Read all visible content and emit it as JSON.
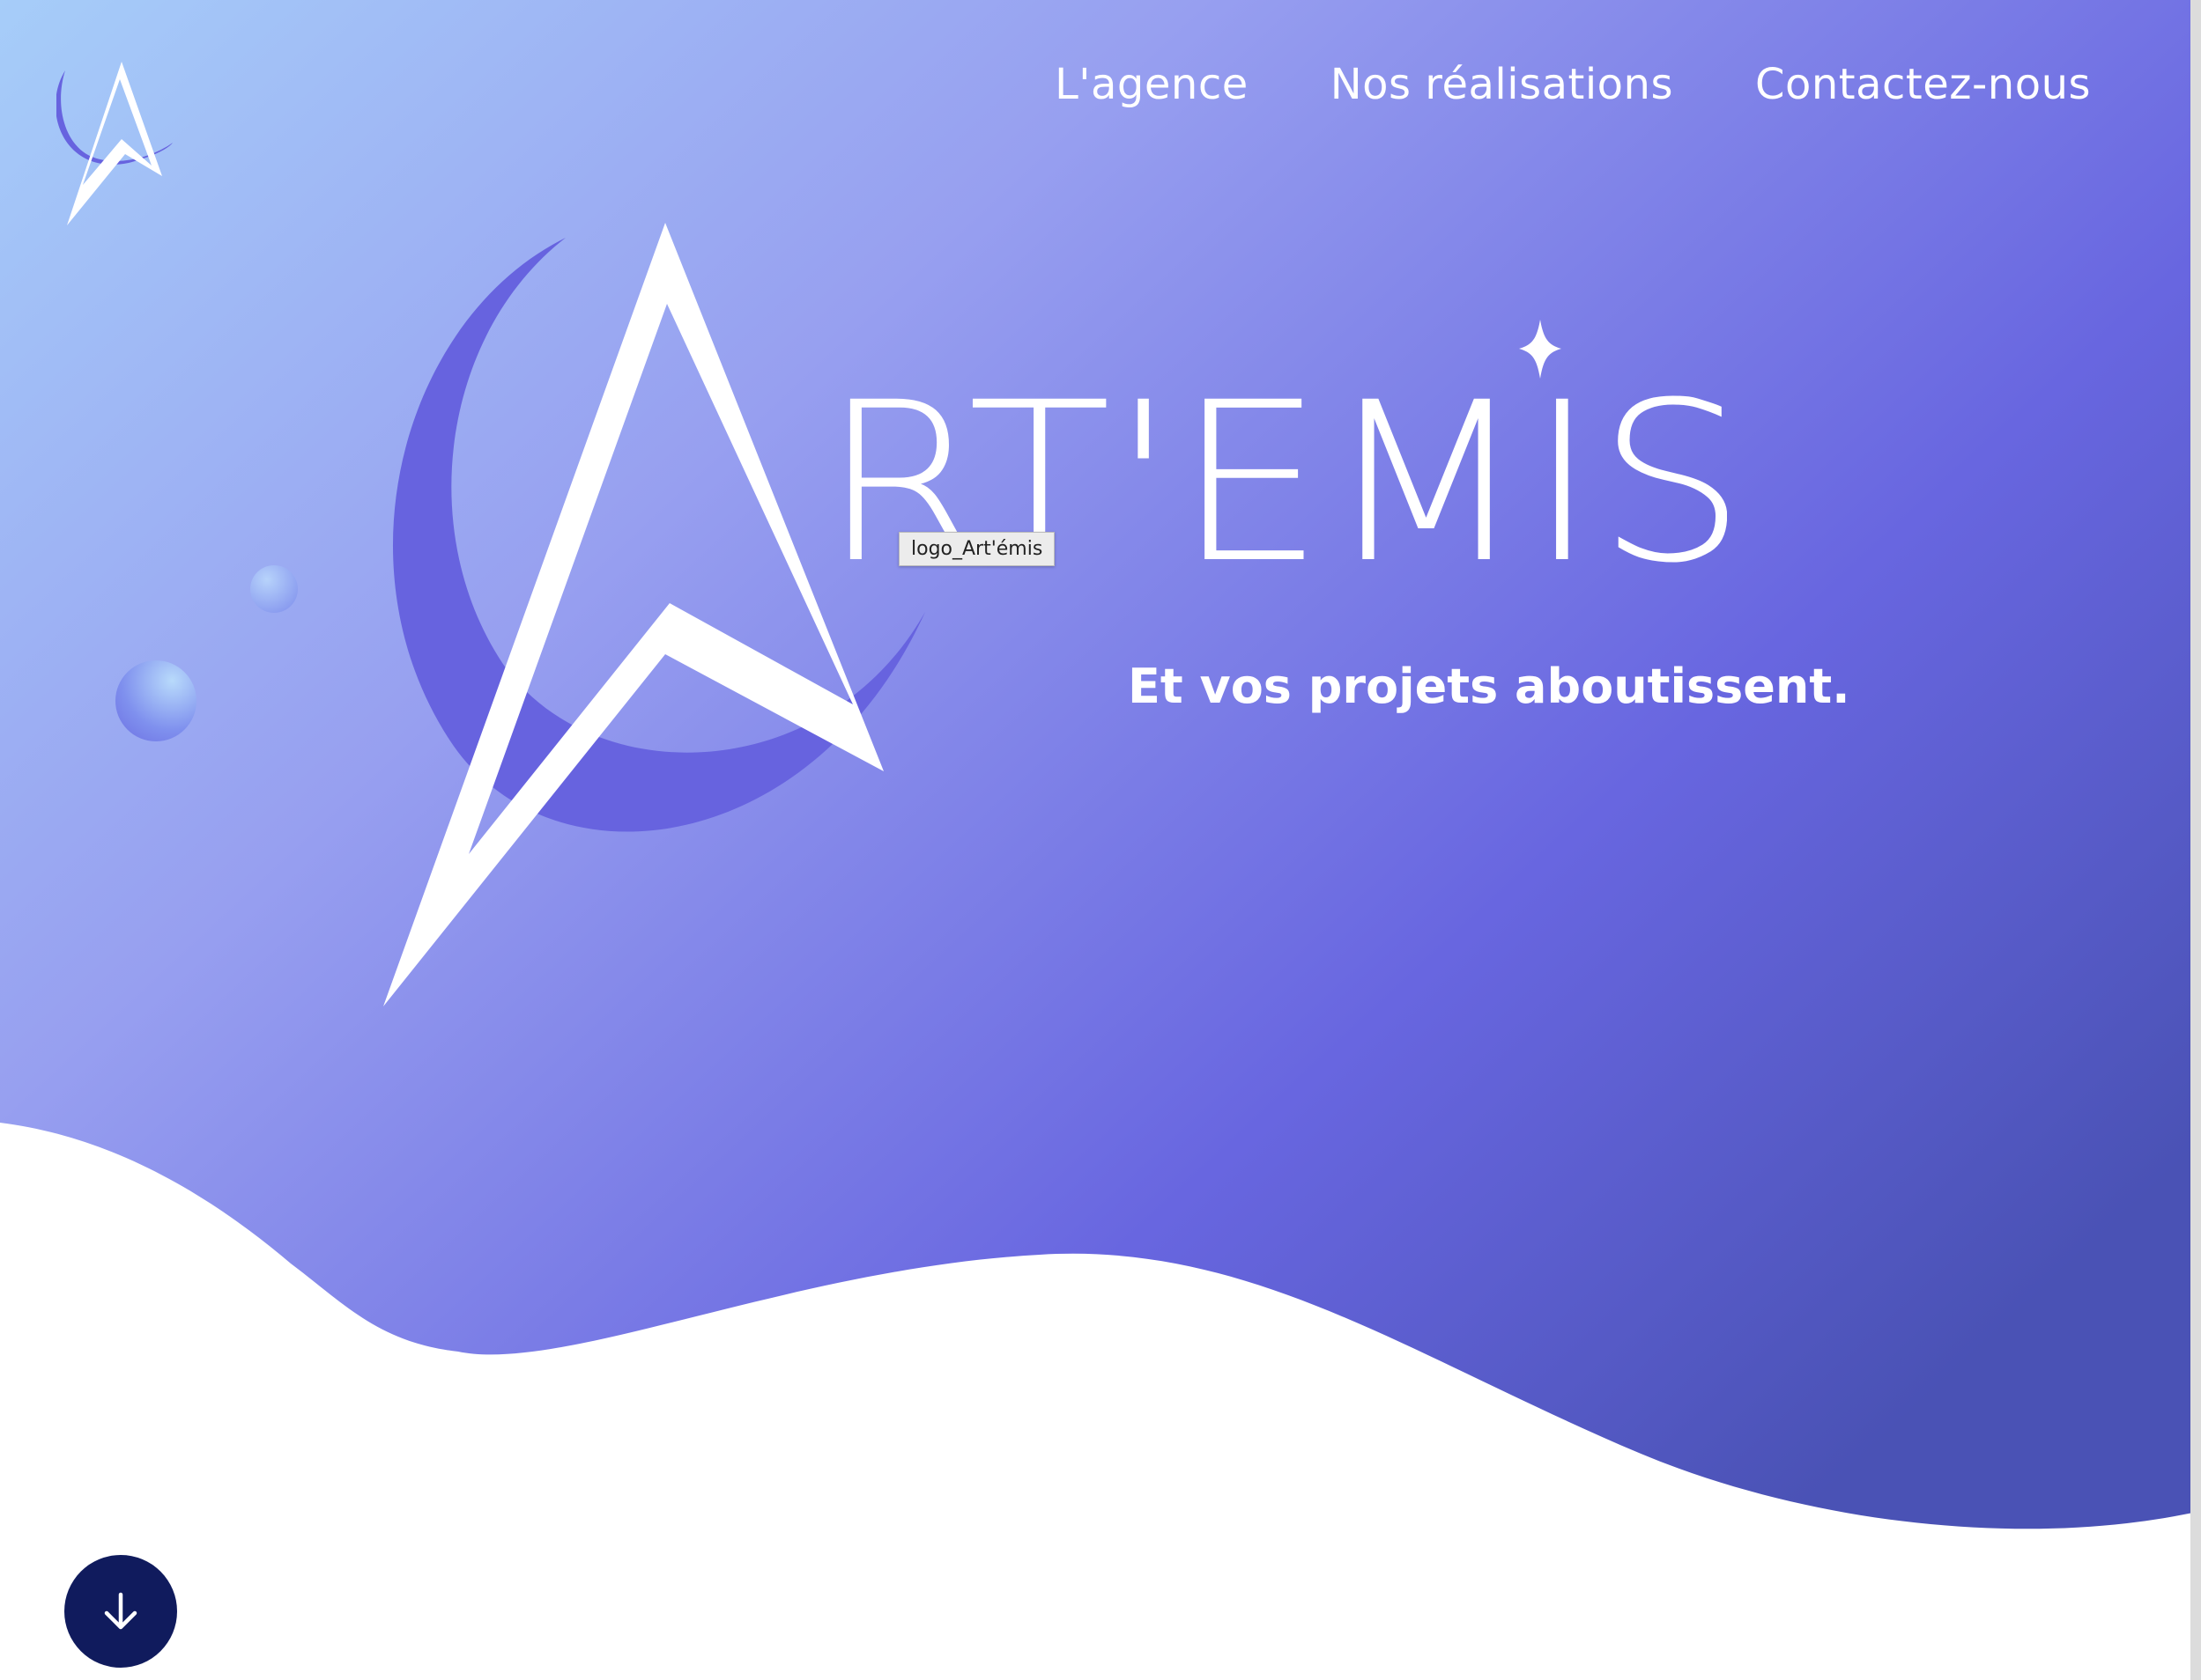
{
  "nav": {
    "items": [
      {
        "label": "L'agence"
      },
      {
        "label": "Nos réalisations"
      },
      {
        "label": "Contactez-nous"
      }
    ]
  },
  "brand": {
    "logo_text": "RT'EMIS"
  },
  "hero": {
    "tagline": "Et vos projets aboutissent."
  },
  "tooltip": {
    "text": "logo_Art'émis"
  },
  "icons": {
    "scroll": "arrow-down-icon"
  },
  "colors": {
    "gradient_start": "#a6cdf9",
    "gradient_mid": "#8a8fec",
    "gradient_end": "#5a5cd9",
    "crescent": "#6763df",
    "scroll_button": "#101b5d"
  }
}
